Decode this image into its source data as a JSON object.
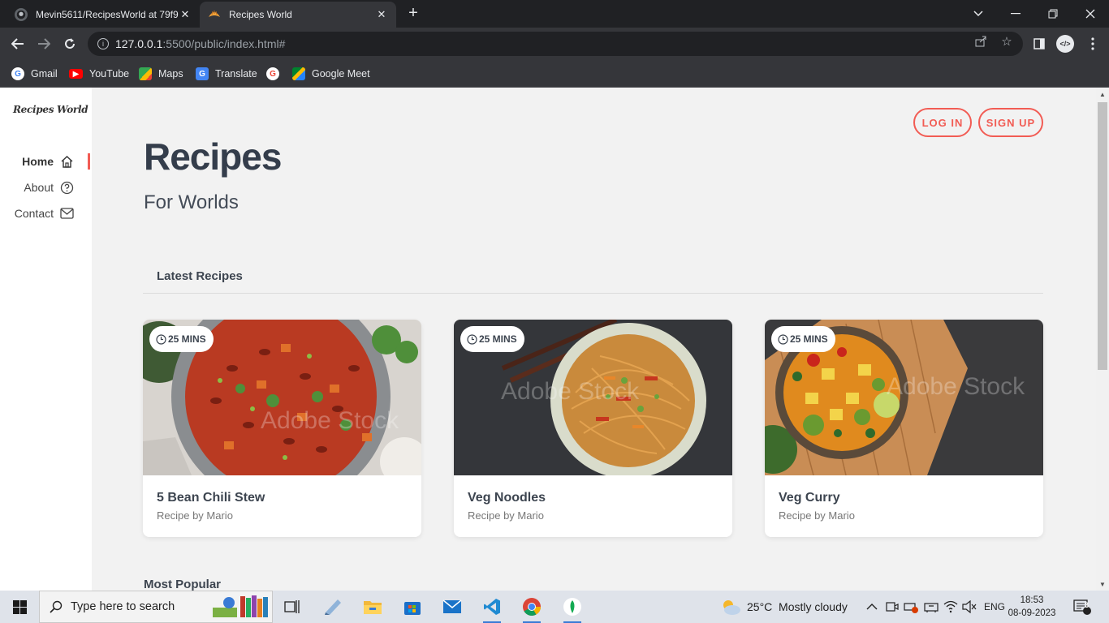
{
  "browser": {
    "tabs": [
      {
        "title": "Mevin5611/RecipesWorld at 79f9",
        "active": false
      },
      {
        "title": "Recipes World",
        "active": true
      }
    ],
    "url_host": "127.0.0.1",
    "url_rest": ":5500/public/index.html#",
    "bookmarks": [
      "Gmail",
      "YouTube",
      "Maps",
      "Translate",
      "",
      "Google Meet"
    ]
  },
  "sidebar": {
    "logo": "Recipes World",
    "nav": [
      {
        "label": "Home",
        "icon": "home-icon",
        "active": true
      },
      {
        "label": "About",
        "icon": "question-circle-icon",
        "active": false
      },
      {
        "label": "Contact",
        "icon": "envelope-icon",
        "active": false
      }
    ]
  },
  "header": {
    "login_label": "LOG IN",
    "signup_label": "SIGN UP",
    "title": "Recipes",
    "subtitle": "For Worlds"
  },
  "latest": {
    "heading": "Latest Recipes",
    "cards": [
      {
        "time": "25 MINS",
        "title": "5 Bean Chili Stew",
        "by": "Recipe by Mario",
        "watermark": "Adobe Stock"
      },
      {
        "time": "25 MINS",
        "title": "Veg Noodles",
        "by": "Recipe by Mario",
        "watermark": "Adobe Stock"
      },
      {
        "time": "25 MINS",
        "title": "Veg Curry",
        "by": "Recipe by Mario",
        "watermark": "Adobe Stock"
      }
    ]
  },
  "popular": {
    "heading": "Most Popular"
  },
  "taskbar": {
    "search_placeholder": "Type here to search",
    "weather": "25°C  Mostly cloudy",
    "language": "ENG",
    "time": "18:53",
    "date": "08-09-2023",
    "notifications": "3"
  },
  "colors": {
    "accent": "#f25c54",
    "heading": "#343d4b"
  }
}
